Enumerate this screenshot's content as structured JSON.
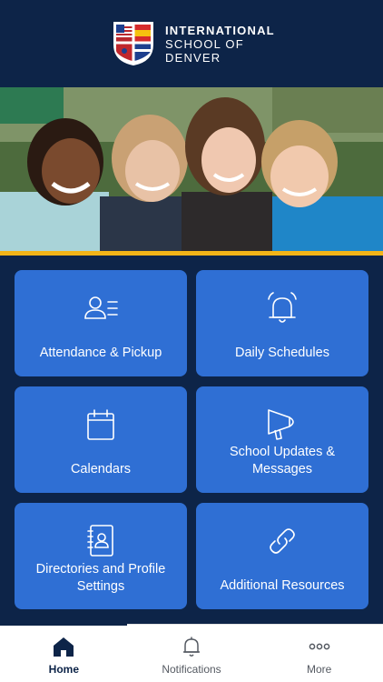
{
  "app": {
    "logo_lines": [
      "INTERNATIONAL",
      "SCHOOL OF",
      "DENVER"
    ],
    "colors": {
      "navy": "#0d2448",
      "tile_blue": "#2f6fd4",
      "accent_gold": "#f2b418"
    }
  },
  "hero": {
    "image": "photo of four smiling children"
  },
  "tiles": [
    {
      "label": "Attendance & Pickup",
      "icon": "attendance-list-icon"
    },
    {
      "label": "Daily Schedules",
      "icon": "bell-icon"
    },
    {
      "label": "Calendars",
      "icon": "calendar-icon"
    },
    {
      "label": "School Updates & Messages",
      "icon": "megaphone-icon"
    },
    {
      "label": "Directories and Profile Settings",
      "icon": "directory-book-icon"
    },
    {
      "label": "Additional Resources",
      "icon": "link-icon"
    }
  ],
  "tabbar": {
    "items": [
      {
        "label": "Home",
        "icon": "home-icon",
        "active": true
      },
      {
        "label": "Notifications",
        "icon": "bell-icon",
        "active": false
      },
      {
        "label": "More",
        "icon": "more-dots-icon",
        "active": false
      }
    ]
  }
}
